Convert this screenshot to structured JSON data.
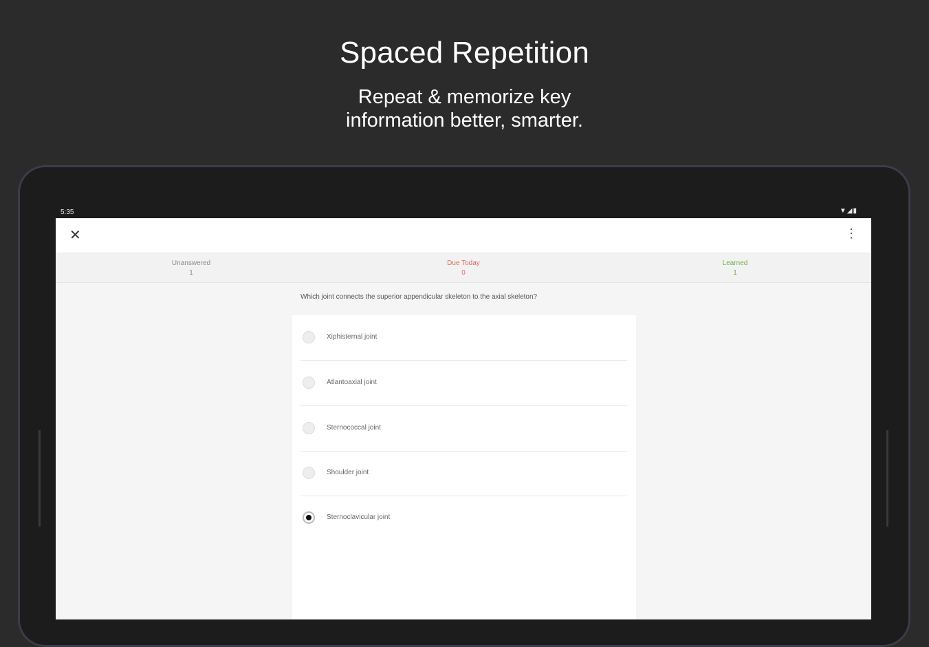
{
  "promo": {
    "title": "Spaced Repetition",
    "subtitle_line1": "Repeat & memorize key",
    "subtitle_line2": "information better, smarter."
  },
  "status_bar": {
    "time": "5:35",
    "icons": "▼◢▮"
  },
  "app_bar": {
    "close_icon": "✕",
    "more_icon": "⋮"
  },
  "stats": {
    "unanswered": {
      "label": "Unanswered",
      "value": "1"
    },
    "due_today": {
      "label": "Due Today",
      "value": "0"
    },
    "learned": {
      "label": "Learned",
      "value": "1"
    }
  },
  "question": "Which joint connects the superior appendicular skeleton to the axial skeleton?",
  "options": [
    {
      "label": "Xiphisternal joint",
      "selected": false
    },
    {
      "label": "Atlantoaxial joint",
      "selected": false
    },
    {
      "label": "Sternococcal joint",
      "selected": false
    },
    {
      "label": "Shoulder joint",
      "selected": false
    },
    {
      "label": "Sternoclavicular joint",
      "selected": true
    }
  ],
  "colors": {
    "background": "#2b2b2b",
    "due_today": "#e06a5a",
    "learned": "#6ab04c"
  }
}
